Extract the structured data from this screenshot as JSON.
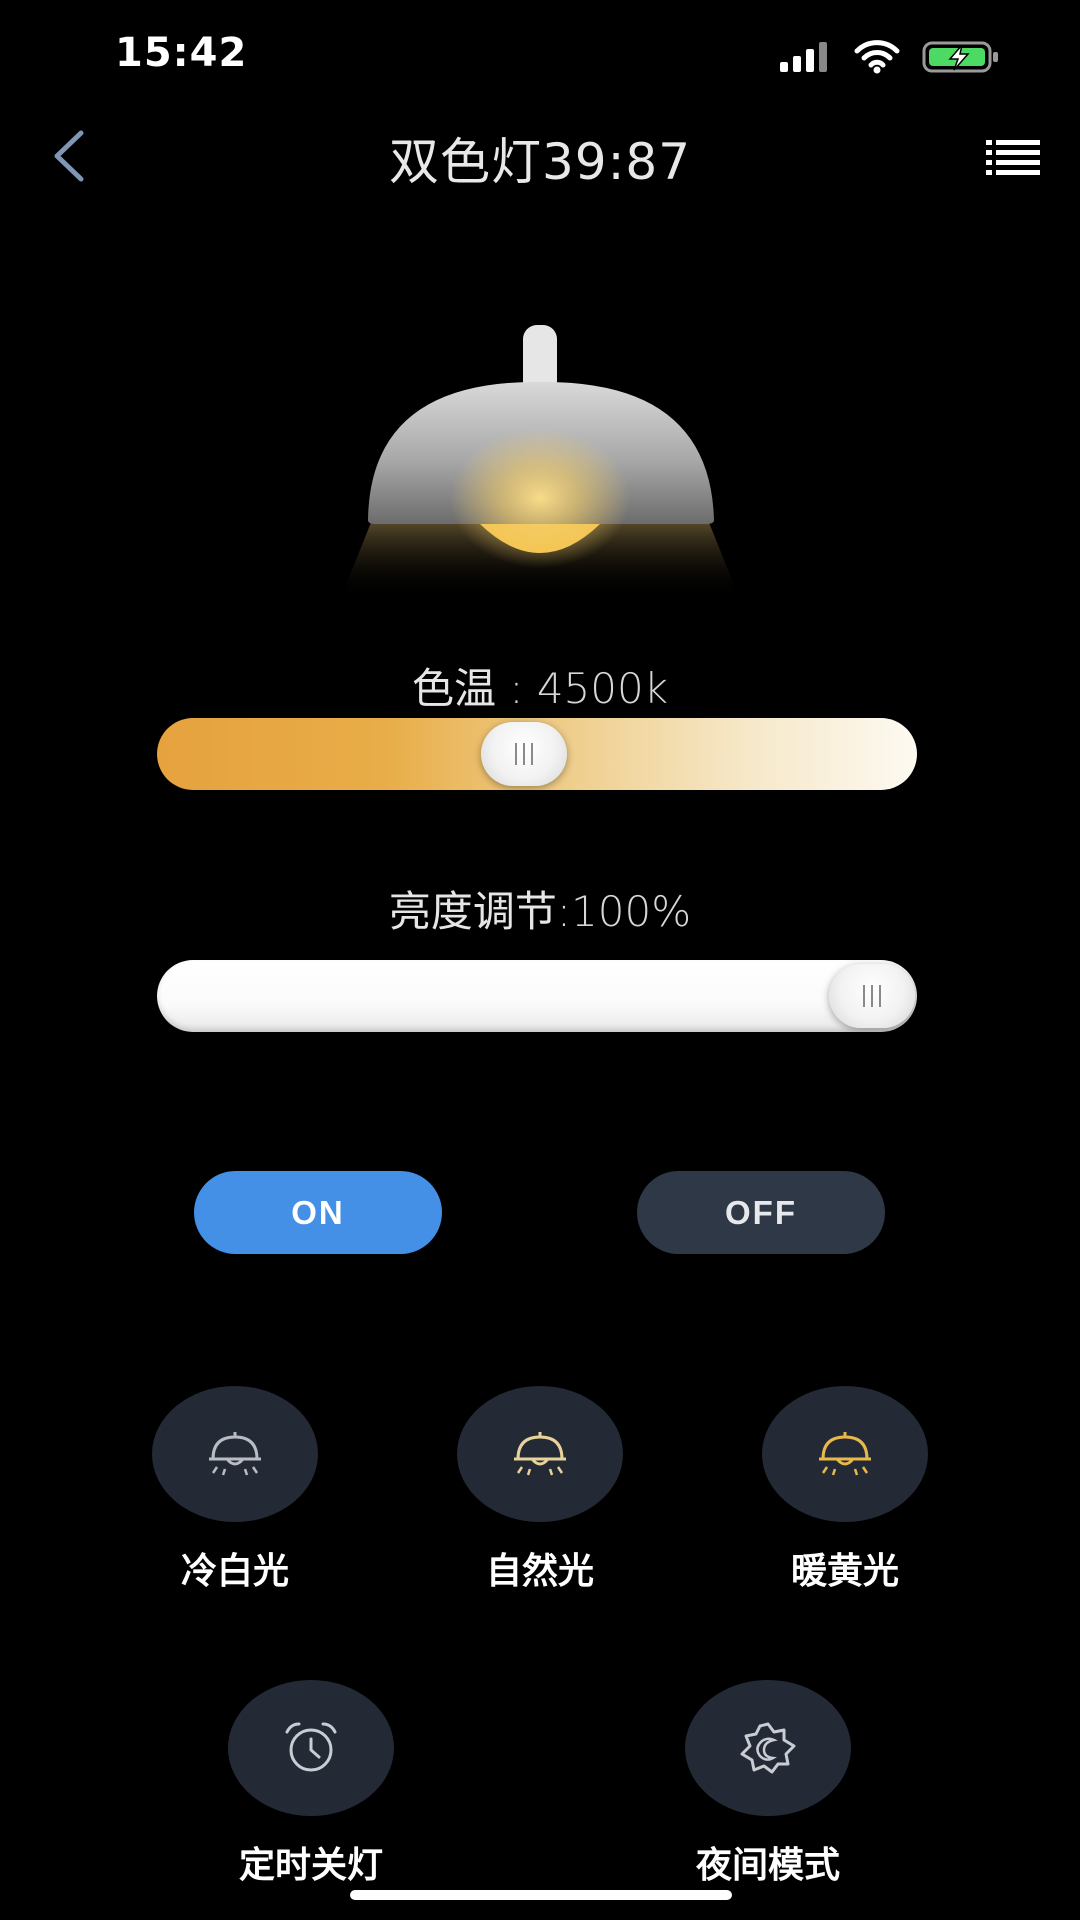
{
  "status_bar": {
    "time": "15:42",
    "battery_color": "#4cd964"
  },
  "header": {
    "title": "双色灯39:87"
  },
  "color_temperature": {
    "label": "色温",
    "separator": " : ",
    "value": "4500k",
    "fraction": 0.48
  },
  "brightness": {
    "label": "亮度调节",
    "separator": ":",
    "value": "100%",
    "fraction": 1.0
  },
  "power": {
    "on_label": "ON",
    "off_label": "OFF",
    "on_color": "#4390e6",
    "off_color": "#2f3846"
  },
  "modes": [
    {
      "label": "冷白光",
      "icon": "lamp-icon",
      "color": "#b9bcc2"
    },
    {
      "label": "自然光",
      "icon": "lamp-icon",
      "color": "#e8d49a"
    },
    {
      "label": "暖黄光",
      "icon": "lamp-icon",
      "color": "#e9b84a"
    }
  ],
  "functions": [
    {
      "label": "定时关灯",
      "icon": "alarm-clock-icon"
    },
    {
      "label": "夜间模式",
      "icon": "night-mode-icon"
    }
  ]
}
